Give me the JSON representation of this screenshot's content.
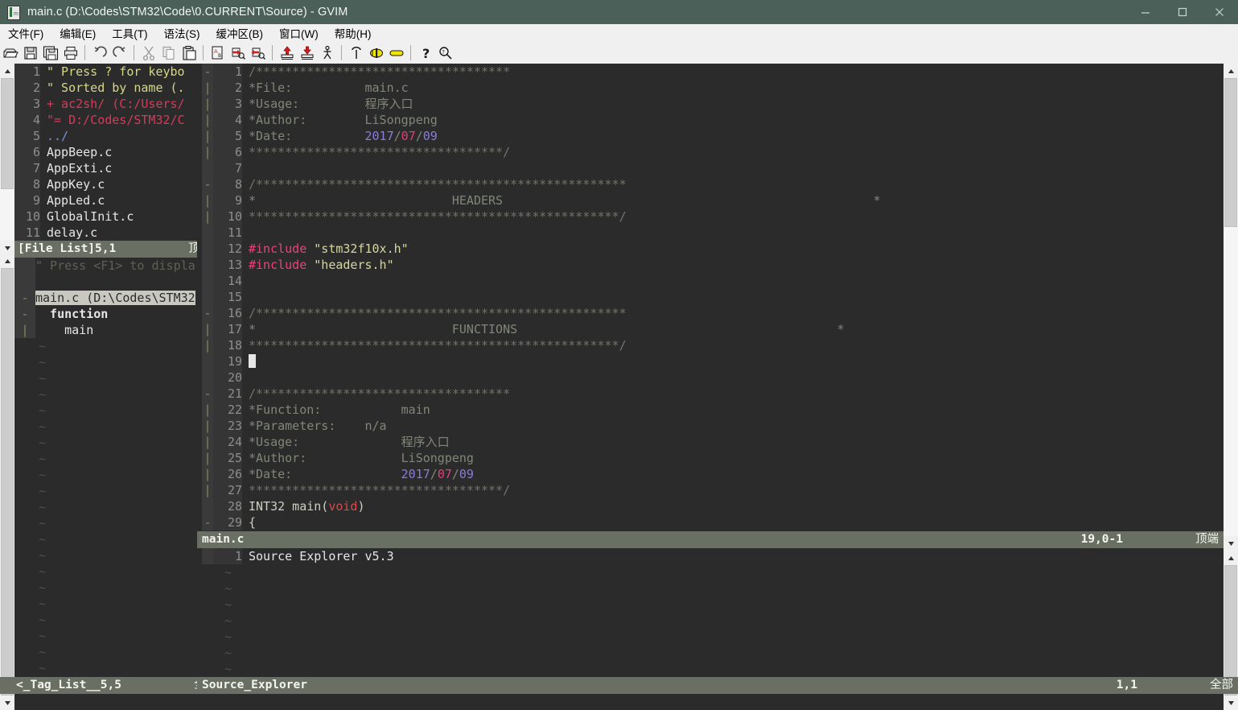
{
  "window": {
    "title": "main.c (D:\\Codes\\STM32\\Code\\0.CURRENT\\Source) - GVIM",
    "icon": "gvim-icon",
    "controls": {
      "minimize": "minimize-icon",
      "maximize": "maximize-icon",
      "close": "close-icon"
    },
    "titlebar_bg": "#4a6059"
  },
  "menubar": {
    "items": [
      {
        "label": "文件(F)",
        "name": "menu-file"
      },
      {
        "label": "编辑(E)",
        "name": "menu-edit"
      },
      {
        "label": "工具(T)",
        "name": "menu-tools"
      },
      {
        "label": "语法(S)",
        "name": "menu-syntax"
      },
      {
        "label": "缓冲区(B)",
        "name": "menu-buffers"
      },
      {
        "label": "窗口(W)",
        "name": "menu-window"
      },
      {
        "label": "帮助(H)",
        "name": "menu-help"
      }
    ]
  },
  "toolbar": {
    "buttons": [
      "open-file-icon",
      "save-file-icon",
      "save-all-icon",
      "print-icon",
      "undo-icon",
      "redo-icon",
      "cut-icon",
      "copy-icon",
      "paste-icon",
      "find-replace-icon",
      "find-next-icon",
      "find-prev-icon",
      "load-session-icon",
      "save-session-icon",
      "run-script-icon",
      "build-icon",
      "make-icon",
      "shell-icon",
      "help-icon",
      "find-help-icon"
    ]
  },
  "filelist": {
    "lines": [
      {
        "n": "1",
        "fold": "",
        "segs": [
          {
            "t": "\" Press ? for keybo",
            "c": "c-yellow"
          }
        ]
      },
      {
        "n": "2",
        "fold": "",
        "segs": [
          {
            "t": "\" Sorted by name (.",
            "c": "c-yellow"
          }
        ]
      },
      {
        "n": "3",
        "fold": "",
        "segs": [
          {
            "t": "+ ac2sh/ (C:/Users/",
            "c": "c-red"
          }
        ]
      },
      {
        "n": "4",
        "fold": "",
        "segs": [
          {
            "t": "\"= D:/Codes/STM32/C",
            "c": "c-red"
          }
        ]
      },
      {
        "n": "5",
        "fold": "",
        "segs": [
          {
            "t": "../",
            "c": "c-blue"
          }
        ]
      },
      {
        "n": "6",
        "fold": "",
        "segs": [
          {
            "t": "AppBeep.c",
            "c": "c-white"
          }
        ]
      },
      {
        "n": "7",
        "fold": "",
        "segs": [
          {
            "t": "AppExti.c",
            "c": "c-white"
          }
        ]
      },
      {
        "n": "8",
        "fold": "",
        "segs": [
          {
            "t": "AppKey.c",
            "c": "c-white"
          }
        ]
      },
      {
        "n": "9",
        "fold": "",
        "segs": [
          {
            "t": "AppLed.c",
            "c": "c-white"
          }
        ]
      },
      {
        "n": "10",
        "fold": "",
        "segs": [
          {
            "t": "GlobalInit.c",
            "c": "c-white"
          }
        ]
      },
      {
        "n": "11",
        "fold": "",
        "segs": [
          {
            "t": "delay.c",
            "c": "c-white"
          }
        ]
      }
    ],
    "status": {
      "name": "[File List]",
      "pos": "5,1",
      "scroll": "顶端"
    }
  },
  "taglist": {
    "lines": [
      {
        "n": "",
        "fold": "",
        "segs": [
          {
            "t": "\" Press <F1> to displa",
            "c": "c-dim"
          }
        ]
      },
      {
        "n": "",
        "fold": "",
        "segs": []
      },
      {
        "n": "",
        "fold": "-",
        "segs": [
          {
            "t": "main.c (D:\\Codes\\STM32",
            "c": "sel-row"
          }
        ],
        "selected": true
      },
      {
        "n": "",
        "fold": "-",
        "segs": [
          {
            "t": "  function",
            "c": "c-white bold"
          }
        ]
      },
      {
        "n": "",
        "fold": "|",
        "segs": [
          {
            "t": "    main",
            "c": "c-white"
          }
        ]
      }
    ],
    "status": {
      "name": "<_Tag_List__",
      "pos": "5,5",
      "scroll": "全部"
    }
  },
  "editor": {
    "lines": [
      {
        "n": "1",
        "fold": "-",
        "segs": [
          {
            "t": "/***********************************",
            "c": "c-comment"
          }
        ]
      },
      {
        "n": "2",
        "fold": "|",
        "segs": [
          {
            "t": "*File:          main.c",
            "c": "c-comment2"
          }
        ]
      },
      {
        "n": "3",
        "fold": "|",
        "segs": [
          {
            "t": "*Usage:         程序入口",
            "c": "c-comment2"
          }
        ]
      },
      {
        "n": "4",
        "fold": "|",
        "segs": [
          {
            "t": "*Author:        LiSongpeng",
            "c": "c-comment2"
          }
        ]
      },
      {
        "n": "5",
        "fold": "|",
        "segs": [
          {
            "t": "*Date:          ",
            "c": "c-comment2"
          },
          {
            "t": "2017",
            "c": "c-num"
          },
          {
            "t": "/",
            "c": "c-comment2"
          },
          {
            "t": "07",
            "c": "c-num2"
          },
          {
            "t": "/",
            "c": "c-comment2"
          },
          {
            "t": "09",
            "c": "c-num"
          }
        ]
      },
      {
        "n": "6",
        "fold": "|",
        "segs": [
          {
            "t": "***********************************/",
            "c": "c-comment"
          }
        ]
      },
      {
        "n": "7",
        "fold": "",
        "segs": []
      },
      {
        "n": "8",
        "fold": "-",
        "segs": [
          {
            "t": "/***************************************************",
            "c": "c-comment"
          }
        ]
      },
      {
        "n": "9",
        "fold": "|",
        "segs": [
          {
            "t": "*                           HEADERS                                                   *",
            "c": "c-comment2"
          }
        ]
      },
      {
        "n": "10",
        "fold": "|",
        "segs": [
          {
            "t": "***************************************************/",
            "c": "c-comment"
          }
        ]
      },
      {
        "n": "11",
        "fold": "",
        "segs": []
      },
      {
        "n": "12",
        "fold": "",
        "segs": [
          {
            "t": "#include",
            "c": "c-pre"
          },
          {
            "t": " ",
            "c": "txt"
          },
          {
            "t": "\"stm32f10x.h\"",
            "c": "c-str"
          }
        ]
      },
      {
        "n": "13",
        "fold": "",
        "segs": [
          {
            "t": "#include",
            "c": "c-pre"
          },
          {
            "t": " ",
            "c": "txt"
          },
          {
            "t": "\"headers.h\"",
            "c": "c-str"
          }
        ]
      },
      {
        "n": "14",
        "fold": "",
        "segs": []
      },
      {
        "n": "15",
        "fold": "",
        "segs": []
      },
      {
        "n": "16",
        "fold": "-",
        "segs": [
          {
            "t": "/***************************************************",
            "c": "c-comment"
          }
        ]
      },
      {
        "n": "17",
        "fold": "|",
        "segs": [
          {
            "t": "*                           FUNCTIONS                                            *",
            "c": "c-comment2"
          }
        ]
      },
      {
        "n": "18",
        "fold": "|",
        "segs": [
          {
            "t": "***************************************************/",
            "c": "c-comment"
          }
        ]
      },
      {
        "n": "19",
        "fold": "",
        "segs": [],
        "cursor": true
      },
      {
        "n": "20",
        "fold": "",
        "segs": []
      },
      {
        "n": "21",
        "fold": "-",
        "segs": [
          {
            "t": "/***********************************",
            "c": "c-comment"
          }
        ]
      },
      {
        "n": "22",
        "fold": "|",
        "segs": [
          {
            "t": "*Function:           main",
            "c": "c-comment2"
          }
        ]
      },
      {
        "n": "23",
        "fold": "|",
        "segs": [
          {
            "t": "*Parameters:    n/a",
            "c": "c-comment2"
          }
        ]
      },
      {
        "n": "24",
        "fold": "|",
        "segs": [
          {
            "t": "*Usage:              程序入口",
            "c": "c-comment2"
          }
        ]
      },
      {
        "n": "25",
        "fold": "|",
        "segs": [
          {
            "t": "*Author:             LiSongpeng",
            "c": "c-comment2"
          }
        ]
      },
      {
        "n": "26",
        "fold": "|",
        "segs": [
          {
            "t": "*Date:               ",
            "c": "c-comment2"
          },
          {
            "t": "2017",
            "c": "c-num"
          },
          {
            "t": "/",
            "c": "c-comment2"
          },
          {
            "t": "07",
            "c": "c-num2"
          },
          {
            "t": "/",
            "c": "c-comment2"
          },
          {
            "t": "09",
            "c": "c-num"
          }
        ]
      },
      {
        "n": "27",
        "fold": "|",
        "segs": [
          {
            "t": "***********************************/",
            "c": "c-comment"
          }
        ]
      },
      {
        "n": "28",
        "fold": "",
        "segs": [
          {
            "t": "INT32 main(",
            "c": "c-type"
          },
          {
            "t": "void",
            "c": "c-kw"
          },
          {
            "t": ")",
            "c": "c-type"
          }
        ]
      },
      {
        "n": "29",
        "fold": "-",
        "segs": [
          {
            "t": "{",
            "c": "c-type"
          }
        ]
      }
    ],
    "status": {
      "name": "main.c",
      "pos": "19,0-1",
      "scroll": "顶端"
    }
  },
  "sourceexplorer": {
    "lines": [
      {
        "n": "1",
        "fold": "",
        "segs": [
          {
            "t": "Source Explorer v5.3",
            "c": "c-white"
          }
        ]
      }
    ],
    "status": {
      "name": "Source_Explorer",
      "pos": "1,1",
      "scroll": "全部"
    }
  },
  "colors": {
    "bg": "#2b2b2b",
    "statusbar": "#6a6f63",
    "numbercol": "#353535",
    "titlebar": "#4a6059",
    "toolbar": "#f0f0f0"
  }
}
